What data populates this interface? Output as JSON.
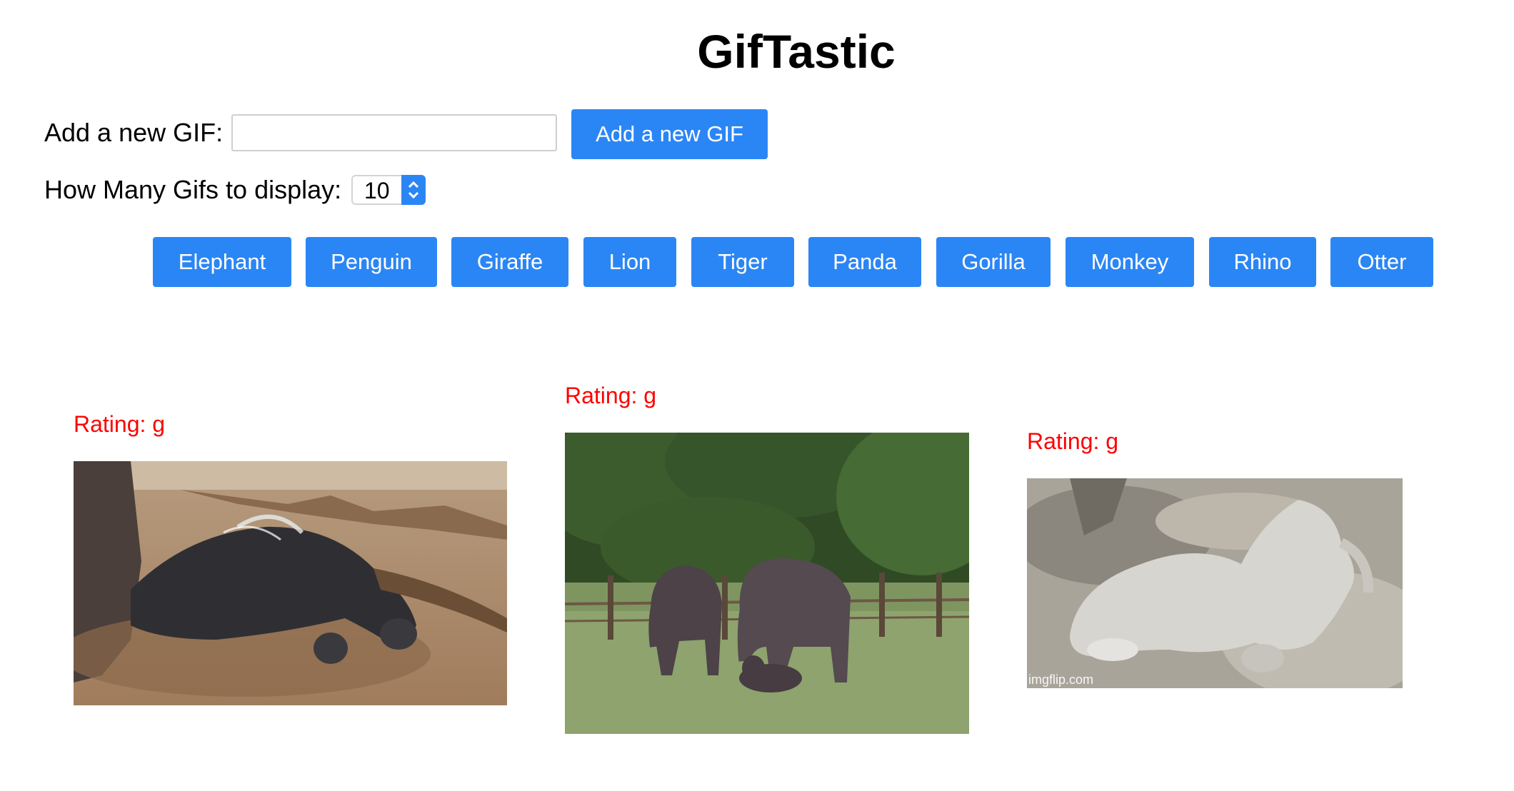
{
  "header": {
    "title": "GifTastic"
  },
  "add_form": {
    "label": "Add a new GIF:",
    "input_value": "",
    "input_placeholder": "",
    "button_label": "Add a new GIF"
  },
  "count_selector": {
    "label": "How Many Gifs to display:",
    "selected_value": "10"
  },
  "topics": [
    "Elephant",
    "Penguin",
    "Giraffe",
    "Lion",
    "Tiger",
    "Panda",
    "Gorilla",
    "Monkey",
    "Rhino",
    "Otter"
  ],
  "results": [
    {
      "rating": "Rating: g",
      "image": "baby elephant splashing in mud"
    },
    {
      "rating": "Rating: g",
      "image": "elephant herd with calf in field"
    },
    {
      "rating": "Rating: g",
      "image": "baby elephant rolling in sand",
      "watermark": "imgflip.com"
    }
  ],
  "colors": {
    "button_blue": "#2b86f5",
    "rating_red": "#ff0000"
  }
}
